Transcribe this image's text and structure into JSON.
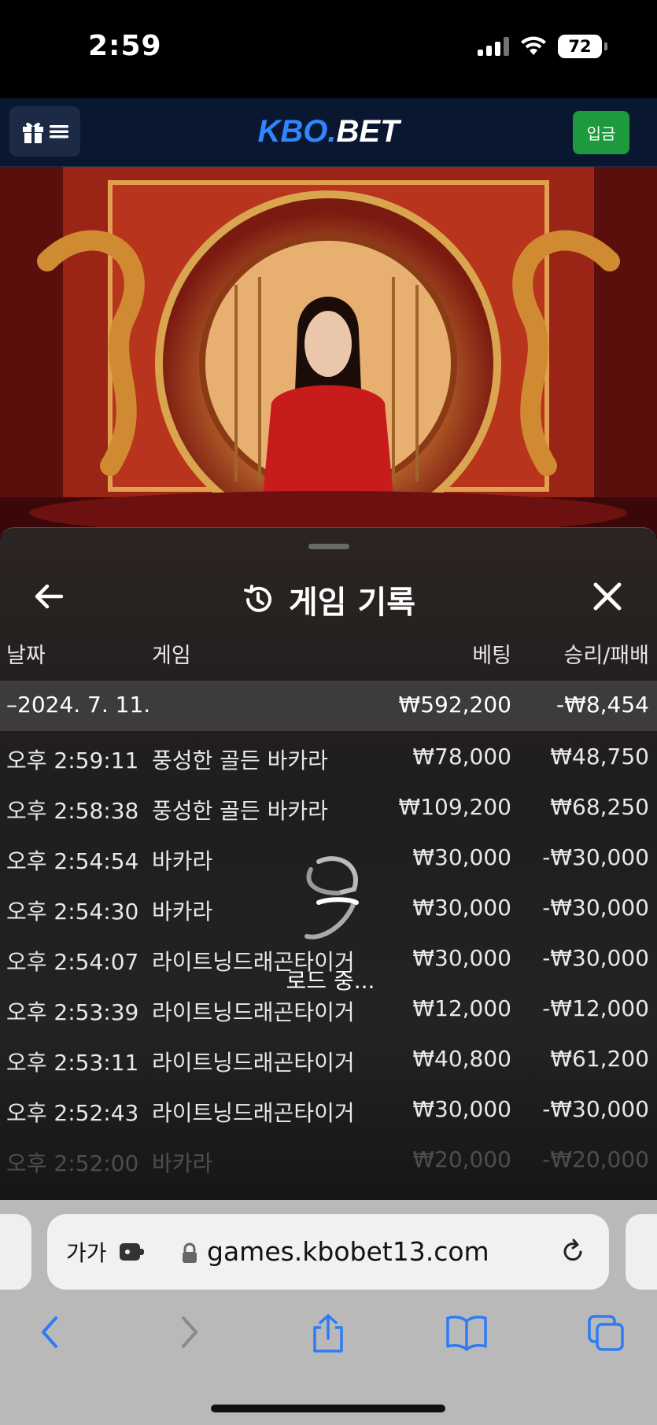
{
  "status_bar": {
    "time": "2:59",
    "battery": "72"
  },
  "app_header": {
    "logo_kbo": "KBO.",
    "logo_bet": "BET",
    "deposit_label": "입금"
  },
  "panel": {
    "title": "게임 기록",
    "columns": {
      "date": "날짜",
      "game": "게임",
      "bet": "베팅",
      "win_loss": "승리/패배"
    },
    "summary": {
      "date": "–2024. 7. 11.",
      "bet": "₩592,200",
      "win_loss": "-₩8,454"
    },
    "rows": [
      {
        "time": "오후 2:59:11",
        "game": "풍성한 골든 바카라",
        "bet": "₩78,000",
        "win_loss": "₩48,750"
      },
      {
        "time": "오후 2:58:38",
        "game": "풍성한 골든 바카라",
        "bet": "₩109,200",
        "win_loss": "₩68,250"
      },
      {
        "time": "오후 2:54:54",
        "game": "바카라",
        "bet": "₩30,000",
        "win_loss": "-₩30,000"
      },
      {
        "time": "오후 2:54:30",
        "game": "바카라",
        "bet": "₩30,000",
        "win_loss": "-₩30,000"
      },
      {
        "time": "오후 2:54:07",
        "game": "라이트닝드래곤타이거",
        "bet": "₩30,000",
        "win_loss": "-₩30,000"
      },
      {
        "time": "오후 2:53:39",
        "game": "라이트닝드래곤타이거",
        "bet": "₩12,000",
        "win_loss": "-₩12,000"
      },
      {
        "time": "오후 2:53:11",
        "game": "라이트닝드래곤타이거",
        "bet": "₩40,800",
        "win_loss": "₩61,200"
      },
      {
        "time": "오후 2:52:43",
        "game": "라이트닝드래곤타이거",
        "bet": "₩30,000",
        "win_loss": "-₩30,000"
      },
      {
        "time": "오후 2:52:00",
        "game": "바카라",
        "bet": "₩20,000",
        "win_loss": "-₩20,000"
      }
    ],
    "loading_text": "로드 중..."
  },
  "browser": {
    "text_size": "가가",
    "url": "games.kbobet13.com"
  },
  "colors": {
    "accent_blue": "#2f86ff",
    "deposit_green": "#1c9a3c",
    "ios_blue": "#2d7cf6"
  }
}
